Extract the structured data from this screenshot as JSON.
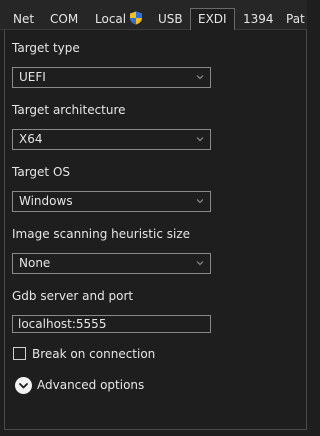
{
  "tabs": [
    {
      "label": "Net"
    },
    {
      "label": "COM"
    },
    {
      "label": "Local",
      "icon": "uac-shield-icon"
    },
    {
      "label": "USB"
    },
    {
      "label": "EXDI",
      "selected": true
    },
    {
      "label": "1394"
    },
    {
      "label": "Pat"
    }
  ],
  "form": {
    "target_type": {
      "label": "Target type",
      "value": "UEFI"
    },
    "target_architecture": {
      "label": "Target architecture",
      "value": "X64"
    },
    "target_os": {
      "label": "Target OS",
      "value": "Windows"
    },
    "image_scanning": {
      "label": "Image scanning heuristic size",
      "value": "None"
    },
    "gdb_server": {
      "label": "Gdb server and port",
      "value": "localhost:5555"
    },
    "break_on_connection": {
      "label": "Break on connection",
      "checked": false
    },
    "advanced_options": {
      "label": "Advanced options",
      "icon": "chevron-down-circle-icon"
    }
  },
  "colors": {
    "background": "#1e1e1e",
    "text": "#e6e6e6",
    "border": "#8a8a8a"
  }
}
